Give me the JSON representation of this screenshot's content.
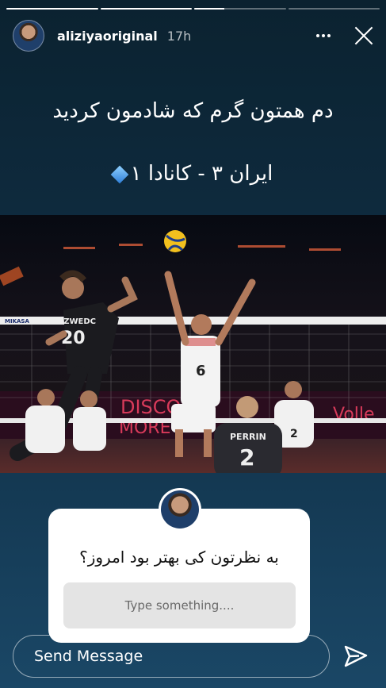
{
  "progress": [
    1,
    1,
    0.33,
    0
  ],
  "header": {
    "username": "aliziyaoriginal",
    "time": "17h"
  },
  "caption": {
    "line1": "دم همتون گرم که شادمون کردید",
    "line2": "ایران ۳ - کانادا ۱"
  },
  "photo": {
    "banner": "MIKASA",
    "players": [
      {
        "name": "SZWEDC",
        "number": "20"
      },
      {
        "name": "",
        "number": "6"
      },
      {
        "name": "PERRIN",
        "number": "2"
      },
      {
        "name": "",
        "number": "2"
      }
    ],
    "board_text_1": "DISCOVE",
    "board_text_2": "MORE",
    "board_text_3": "Volle"
  },
  "question": {
    "text": "به نظرتون کی بهتر بود امروز؟",
    "placeholder": "Type something...."
  },
  "reply": {
    "placeholder": "Send Message"
  }
}
